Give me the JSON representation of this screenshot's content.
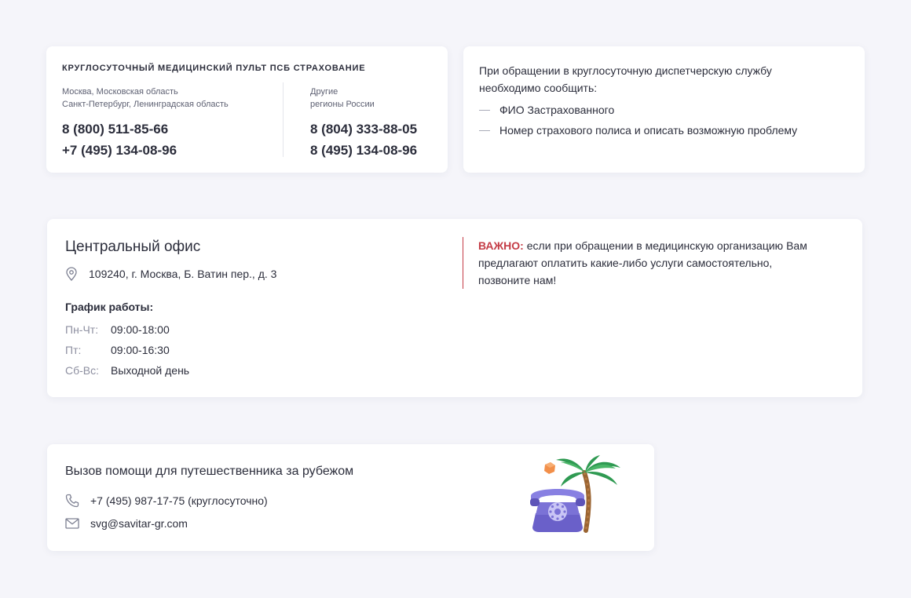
{
  "dispatch": {
    "title": "КРУГЛОСУТОЧНЫЙ МЕДИЦИНСКИЙ ПУЛЬТ ПСБ СТРАХОВАНИЕ",
    "left": {
      "region_line1": "Москва, Московская область",
      "region_line2": "Санкт-Петербург, Ленинградская область",
      "phone1": "8 (800) 511-85-66",
      "phone2": "+7 (495) 134-08-96"
    },
    "right": {
      "region_line1": "Другие",
      "region_line2": "регионы России",
      "phone1": "8 (804) 333-88-05",
      "phone2": "8 (495) 134-08-96"
    }
  },
  "notice": {
    "intro": "При обращении в круглосуточную диспетчерскую службу необходимо сообщить:",
    "items": [
      "ФИО Застрахованного",
      "Номер страхового полиса и описать возможную проблему"
    ]
  },
  "office": {
    "title": "Центральный офис",
    "address": "109240, г. Москва, Б. Ватин пер., д. 3",
    "schedule_title": "График работы:",
    "schedule": [
      {
        "day": "Пн-Чт:",
        "time": "09:00-18:00"
      },
      {
        "day": "Пт:",
        "time": "09:00-16:30"
      },
      {
        "day": "Сб-Вс:",
        "time": "Выходной день"
      }
    ],
    "important_label": "ВАЖНО:",
    "important_text": " если при обращении в медицинскую организацию Вам предлагают оплатить какие-либо услуги самостоятельно, позвоните нам!"
  },
  "travel": {
    "title": "Вызов помощи для путешественника за рубежом",
    "phone": "+7 (495) 987-17-75 (круглосуточно)",
    "email": "svg@savitar-gr.com"
  },
  "icons": {
    "address": "location-pin-icon",
    "phone": "phone-icon",
    "email": "envelope-icon",
    "illustration": "telephone-palm-illustration"
  },
  "colors": {
    "accent_red": "#c43c46",
    "background": "#f5f5fa",
    "phone_purple": "#7b72d6"
  }
}
